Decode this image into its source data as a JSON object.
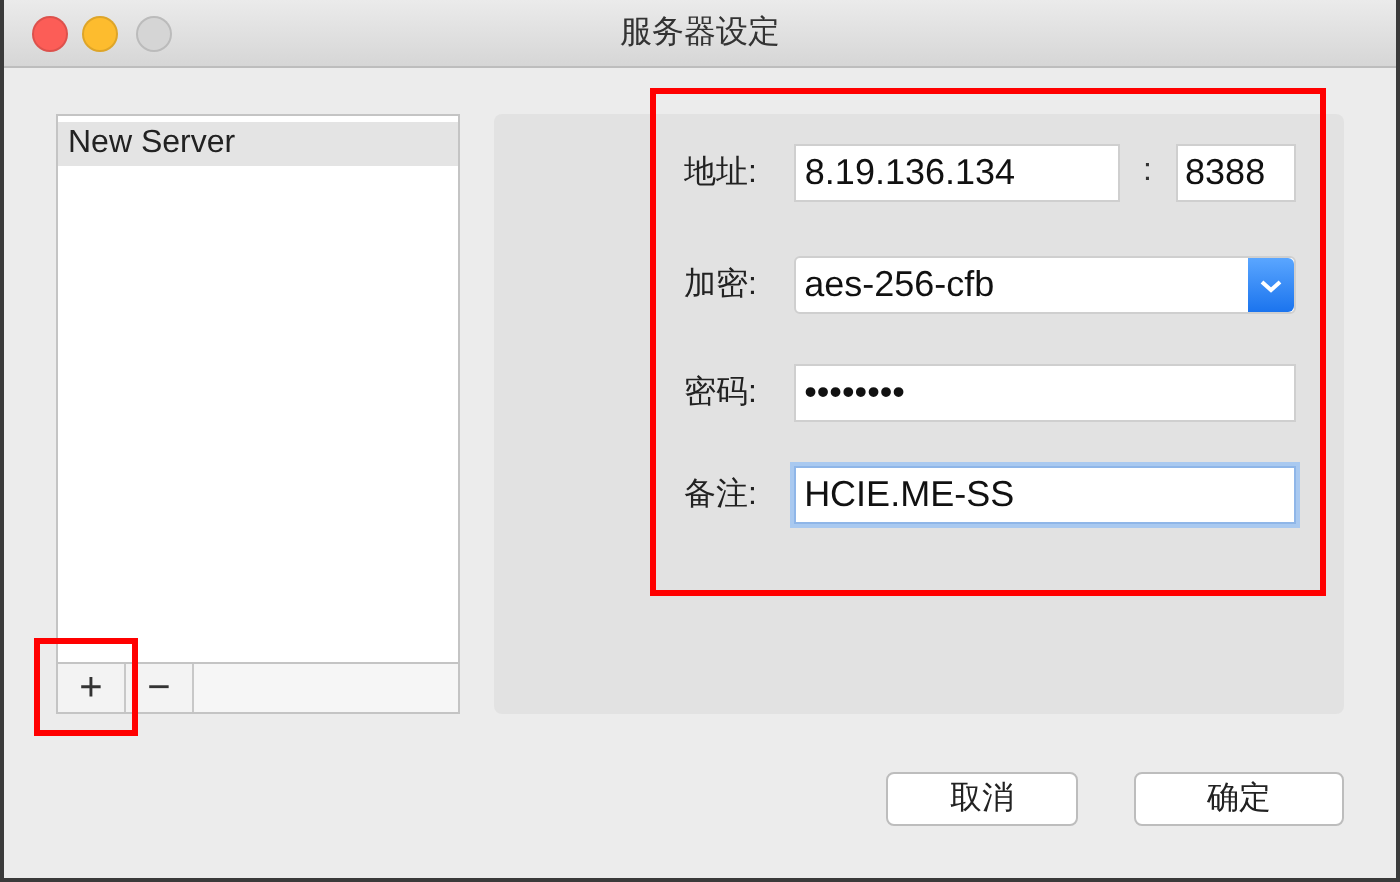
{
  "window": {
    "title": "服务器设定"
  },
  "servers": [
    {
      "name": "New Server",
      "selected": true
    }
  ],
  "list_toolbar": {
    "add": {
      "label": "+",
      "highlighted": true
    },
    "remove": {
      "label": "−"
    }
  },
  "form": {
    "highlighted": true,
    "address": {
      "label": "地址:",
      "value": "8.19.136.134",
      "separator": ":",
      "port": "8388"
    },
    "encryption": {
      "label": "加密:",
      "value": "aes-256-cfb"
    },
    "password": {
      "label": "密码:",
      "value": "••••••••"
    },
    "note": {
      "label": "备注:",
      "value": "HCIE.ME-SS",
      "focused": true
    }
  },
  "buttons": [
    {
      "label": "取消"
    },
    {
      "label": "确定"
    }
  ]
}
